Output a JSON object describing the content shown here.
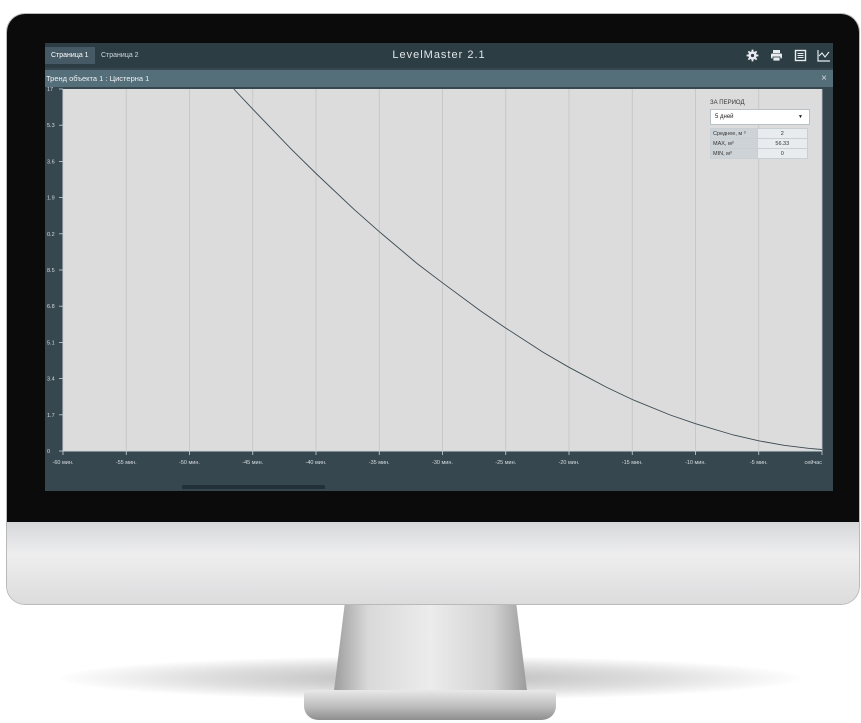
{
  "app": {
    "title": "LevelMaster 2.1"
  },
  "tabs": [
    {
      "label": "Страница 1",
      "active": true
    },
    {
      "label": "Страница 2",
      "active": false
    }
  ],
  "toolbar": {
    "icons": [
      "gear-icon",
      "print-icon",
      "list-icon",
      "chart-icon"
    ]
  },
  "panel": {
    "title": "Тренд объекта 1 : Цистерна 1",
    "close": "×"
  },
  "stats": {
    "period_label": "ЗА ПЕРИОД",
    "period_value": "5 дней",
    "rows": [
      {
        "label": "Среднее, м ³",
        "value": "2"
      },
      {
        "label": "MAX, м³",
        "value": "56.33"
      },
      {
        "label": "MIN, м³",
        "value": "0"
      }
    ]
  },
  "colors": {
    "topbar": "#2d3d44",
    "panel": "#546e7a",
    "plot_bg": "#dcdcdc",
    "line": "#3b4a52"
  },
  "chart_data": {
    "type": "line",
    "x_tick_labels": [
      "-60 мин.",
      "-55 мин.",
      "-50 мин.",
      "-45 мин.",
      "-40 мин.",
      "-35 мин.",
      "-30 мин.",
      "-25 мин.",
      "-20 мин.",
      "-15 мин.",
      "-10 мин.",
      "-5 мин.",
      "сейчас"
    ],
    "y_tick_labels": [
      "0",
      "1.7",
      "3.4",
      "5.1",
      "6.8",
      "8.5",
      "0.2",
      "1.9",
      "3.6",
      "5.3",
      "17"
    ],
    "xlim": [
      -60,
      0
    ],
    "ylim": [
      0,
      17
    ],
    "grid": true,
    "series": [
      {
        "x": [
          -46.5,
          -45,
          -42,
          -40,
          -37,
          -35,
          -32,
          -30,
          -27,
          -25,
          -22,
          -20,
          -17,
          -15,
          -12,
          -10,
          -7,
          -5,
          -3,
          -1,
          0
        ],
        "y": [
          17,
          16.05,
          14.2,
          13.03,
          11.35,
          10.3,
          8.8,
          7.9,
          6.58,
          5.77,
          4.62,
          3.93,
          2.98,
          2.42,
          1.69,
          1.28,
          0.75,
          0.48,
          0.27,
          0.12,
          0.07
        ]
      }
    ]
  }
}
